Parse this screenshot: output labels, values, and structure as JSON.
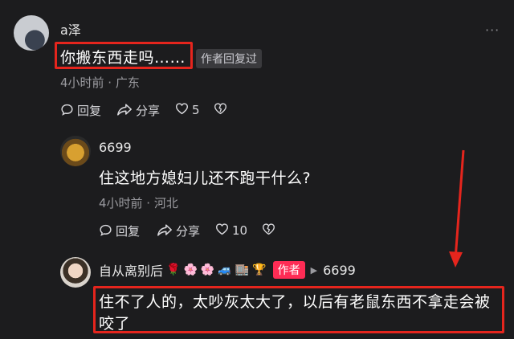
{
  "comment": {
    "user": "a泽",
    "text": "你搬东西走吗……",
    "tag": "作者回复过",
    "meta": "4小时前 · 广东",
    "reply_label": "回复",
    "share_label": "分享",
    "likes": "5",
    "more": "···"
  },
  "reply1": {
    "user": "6699",
    "text": "住这地方媳妇儿还不跑干什么?",
    "meta": "4小时前 · 河北",
    "reply_label": "回复",
    "share_label": "分享",
    "likes": "10"
  },
  "reply2": {
    "user": "自从离别后",
    "emojis": [
      "🌹",
      "🌸",
      "🌸",
      "🚙",
      "🏬",
      "🏆"
    ],
    "author_badge": "作者",
    "reply_to": "6699",
    "text_line1": "住不了人的，太吵灰太大了，以后有老鼠东西不拿走会被",
    "text_line2": "咬了"
  },
  "colors": {
    "highlight": "#e5251d",
    "badge": "#fe2c55",
    "background": "#1c1c1e"
  }
}
